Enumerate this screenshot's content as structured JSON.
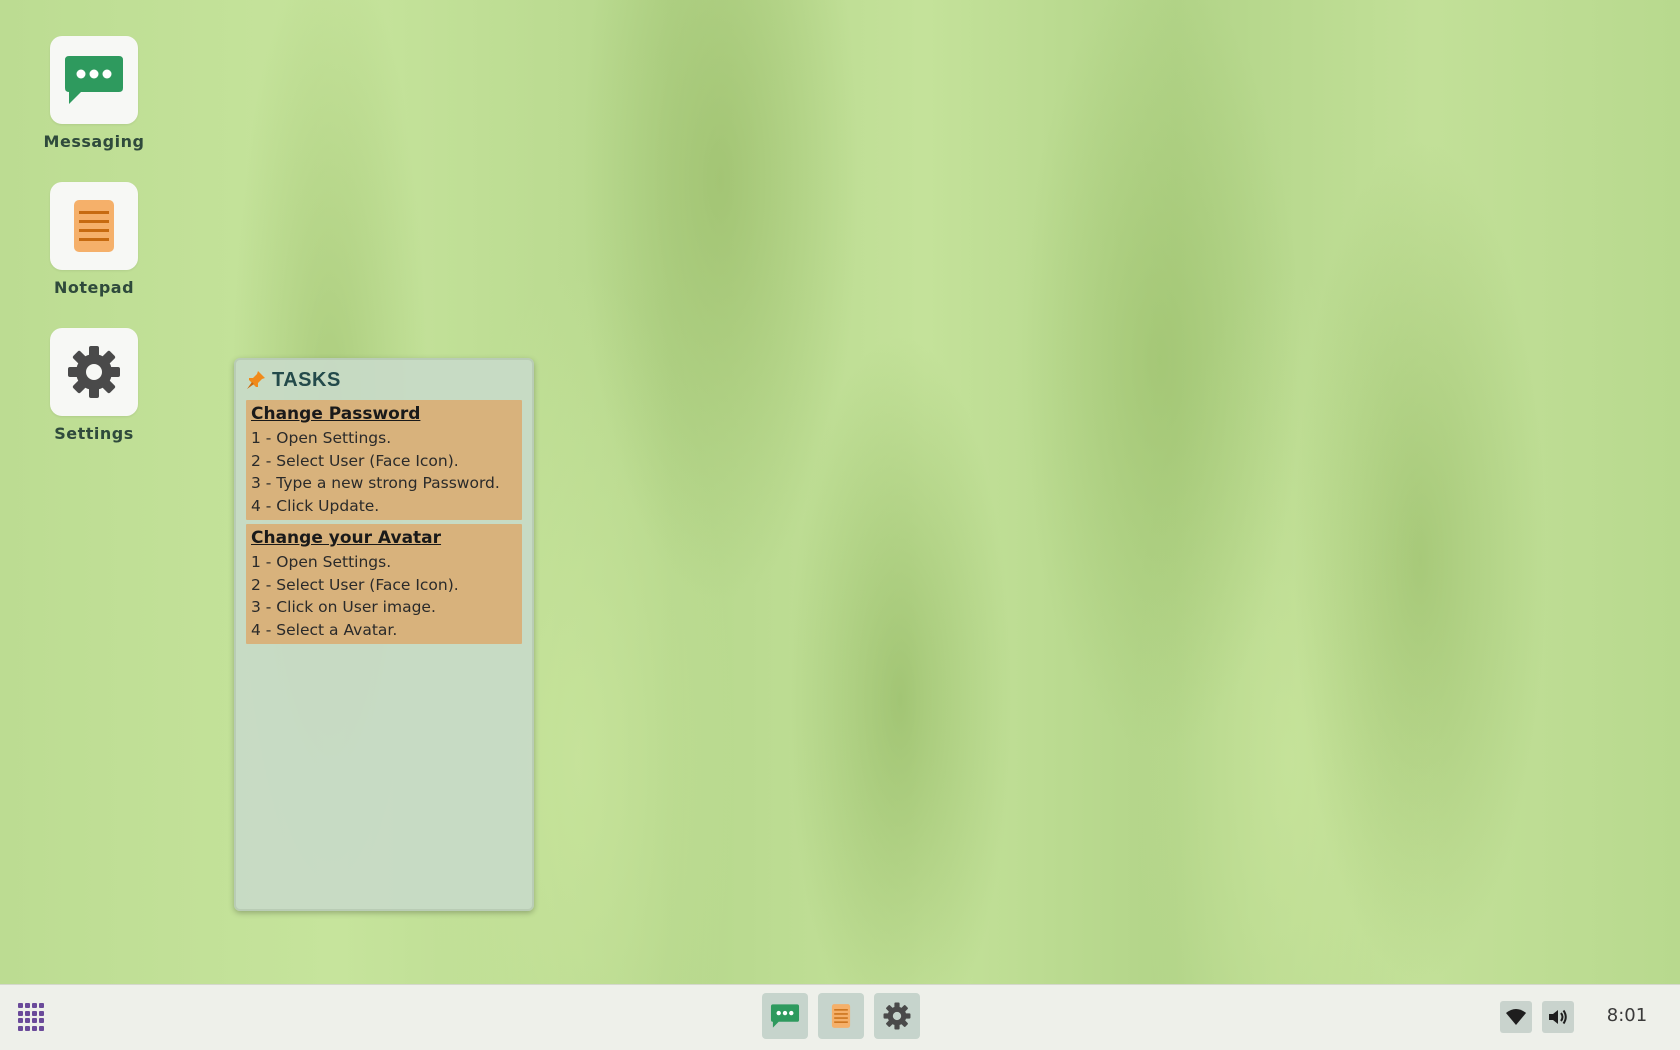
{
  "desktop": {
    "icons": [
      {
        "label": "Messaging",
        "icon": "chat-bubble-icon",
        "color": "#2e9a5e"
      },
      {
        "label": "Notepad",
        "icon": "notepad-icon",
        "color": "#f0a450"
      },
      {
        "label": "Settings",
        "icon": "gear-icon",
        "color": "#4a4a4a"
      }
    ]
  },
  "tasks": {
    "title": "TASKS",
    "icon": "pin-icon",
    "items": [
      {
        "title": "Change Password",
        "steps": [
          "1 - Open Settings.",
          "2 - Select User (Face Icon).",
          "3 - Type a new strong Password.",
          "4 - Click Update."
        ]
      },
      {
        "title": "Change your Avatar",
        "steps": [
          "1 - Open Settings.",
          "2 - Select User (Face Icon).",
          "3 - Click on User image.",
          "4 - Select a Avatar."
        ]
      }
    ]
  },
  "taskbar": {
    "launcher_icon": "app-grid-icon",
    "apps": [
      "chat-bubble-icon",
      "notepad-icon",
      "gear-icon"
    ],
    "tray": [
      "wifi-icon",
      "volume-icon"
    ],
    "clock": "8:01"
  },
  "colors": {
    "task_card": "#d8b27c",
    "panel": "#c8dac8",
    "accent_purple": "#6a4a9a"
  }
}
